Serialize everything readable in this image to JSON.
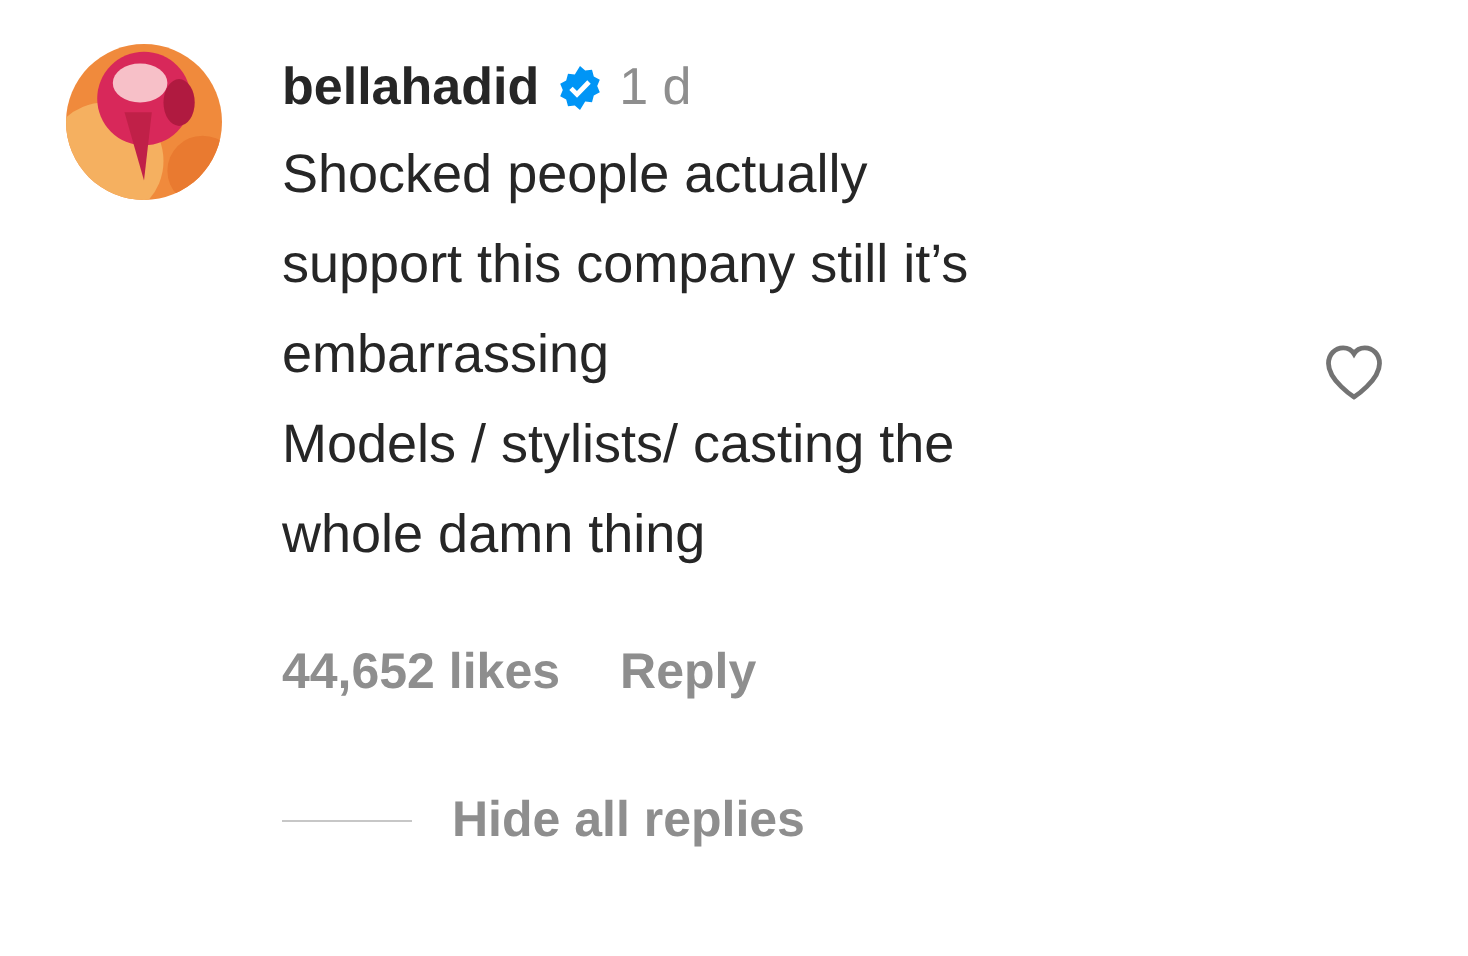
{
  "comment": {
    "username": "bellahadid",
    "verified": true,
    "time": "1 d",
    "text_lines": [
      "Shocked people actually",
      "support this company still it’s",
      "embarrassing",
      "Models / stylists/ casting the",
      "whole damn thing"
    ],
    "liked": false,
    "likes": "44,652 likes",
    "reply": "Reply"
  },
  "replies_toggle": "Hide all replies"
}
